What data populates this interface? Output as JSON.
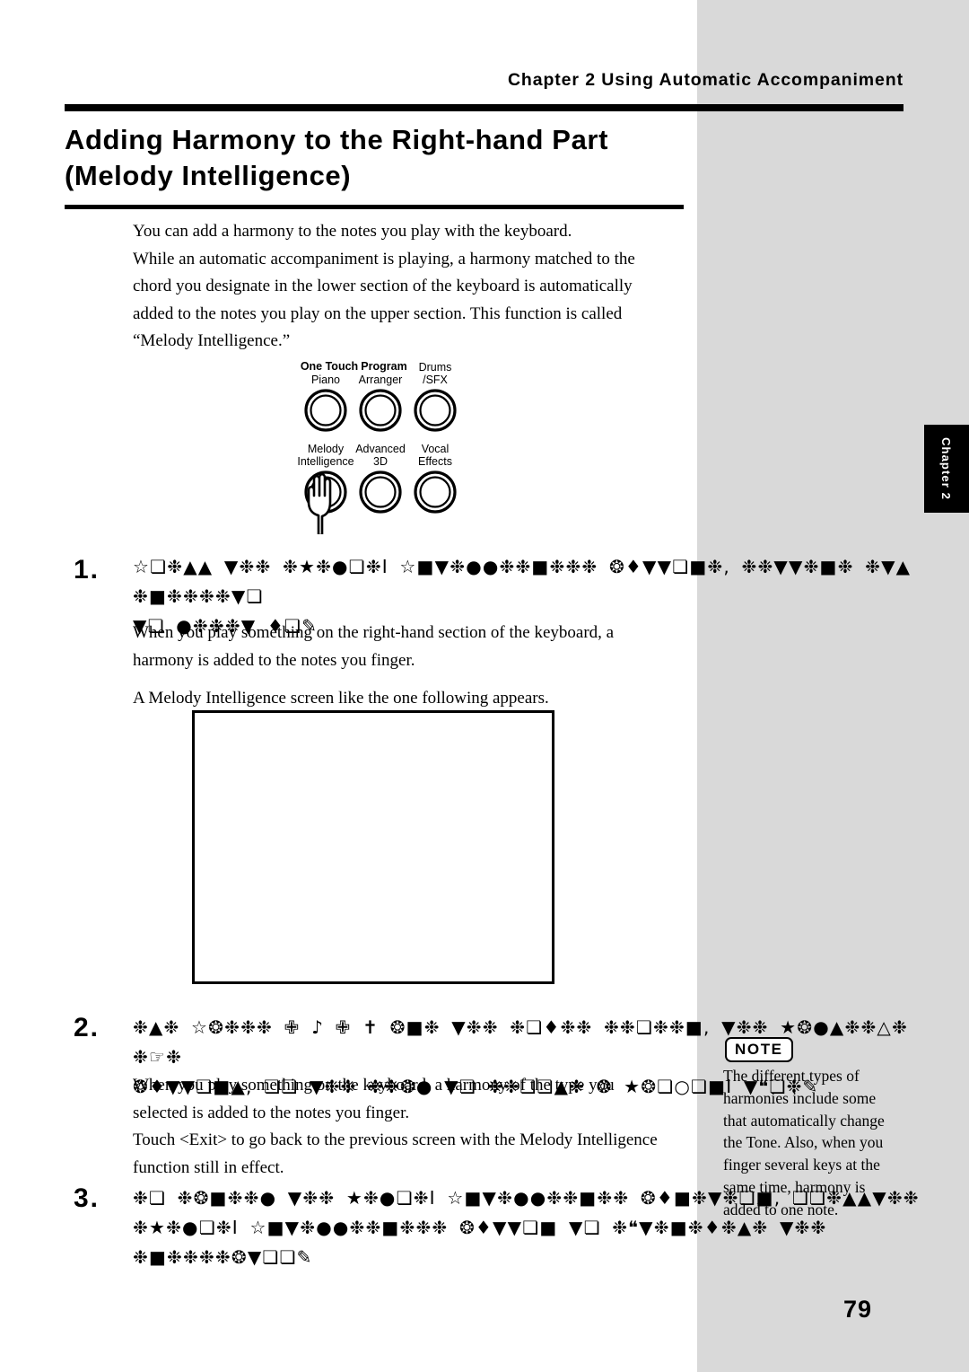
{
  "header": {
    "running_title": "Chapter 2 Using Automatic Accompaniment"
  },
  "title": {
    "line1": "Adding Harmony to the Right-hand Part",
    "line2": "(Melody Intelligence)"
  },
  "side_tab": {
    "label": "Chapter 2"
  },
  "intro": {
    "lines": [
      "You can add a harmony to the notes you play with the keyboard.",
      "While an automatic accompaniment is playing, a harmony matched to the",
      "chord you designate in the lower section of the keyboard is automatically",
      "added to the notes you play on the upper section. This function is called",
      "“Melody Intelligence.”"
    ]
  },
  "panel": {
    "group_label_one_touch": "One Touch",
    "group_label_program": "Program",
    "buttons": [
      {
        "line1": "Piano",
        "line2": ""
      },
      {
        "line1": "Arranger",
        "line2": ""
      },
      {
        "line1": "Drums",
        "line2": "/SFX"
      },
      {
        "line1": "Melody",
        "line2": "Intelligence"
      },
      {
        "line1": "Advanced",
        "line2": "3D"
      },
      {
        "line1": "Vocal",
        "line2": "Effects"
      }
    ],
    "pointer_icon": "pointing-hand-icon"
  },
  "steps": [
    {
      "number": "1.",
      "heading_lines": [
        "☆❏❉▲▲ ▼❉❉ ❉★❉●❏❉I ☆■▼❉●●❉❉■❉❉❉ ❂♦▼▼❏■❉, ❉❉▼▼❉■❉ ❉▼▲ ❉■❉❉❉❉▼❏",
        "▼❏ ●❉❉❉▼ ♦❏✎"
      ],
      "body_lines": [
        "When you play something on the right-hand section of the keyboard, a",
        "harmony is added to the notes you finger.",
        "A Melody Intelligence screen like the one following appears."
      ]
    },
    {
      "number": "2.",
      "heading_lines": [
        "❉▲❉ ☆❂❉❉❉ ✙ ♪ ✙ ✝ ❂■❉ ▼❉❉ ❉❏♦❉❉ ❉❉❏❉❉■, ▼❉❉ ★❂●▲❉❉△❉ ❉☞❉",
        "❂♦▼▼❏■▲, ❏❏ ▼❉❉ ❉❉❂● ▼❏ ❉❉❏❏▲❉ ❂ ★❂❏○❏■I ▼❝❏❉✎"
      ],
      "body_lines": [
        "When you play something on the keyboard, a harmony of the type you",
        "selected is added to the notes you finger.",
        "Touch <Exit> to go back to the previous screen with the Melody Intelligence",
        "function still in effect."
      ]
    },
    {
      "number": "3.",
      "heading_lines": [
        "❉❏ ❉❂■❉❉● ▼❉❉ ★❉●❏❉I ☆■▼❉●●❉❉■❉❉ ❂♦■❉▼❉❏■, ❏❏❉▲▲▼❉❉",
        "❉★❉●❏❉I ☆■▼❉●●❉❉■❉❉❉ ❂♦▼▼❏■ ▼❏ ❉❝▼❉■❉♦❉▲❉ ▼❉❉ ❉■❉❉❉❉❂▼❏❏✎"
      ],
      "body_lines": []
    }
  ],
  "note": {
    "badge": "NOTE",
    "lines": [
      "The different types of",
      "harmonies include some",
      "that automatically change",
      "the Tone. Also, when you",
      "finger several keys at the",
      "same time, harmony is",
      "added to one note."
    ]
  },
  "footer": {
    "page_number": "79"
  }
}
